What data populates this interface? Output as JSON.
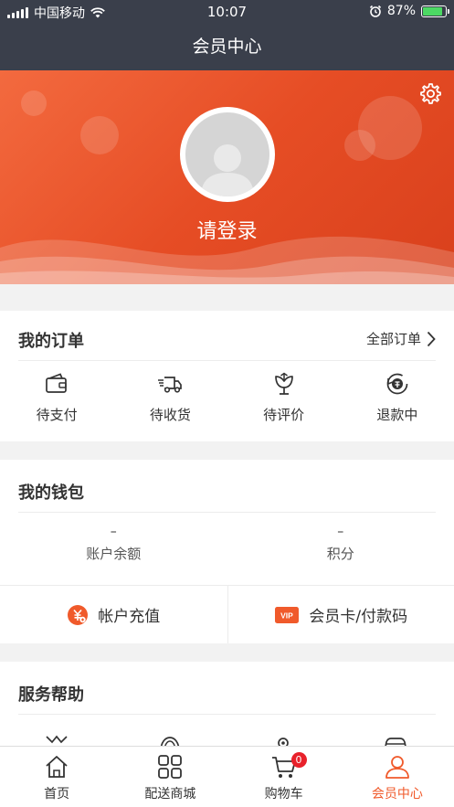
{
  "status": {
    "carrier": "中国移动",
    "time": "10:07",
    "battery": "87%",
    "battery_level": 0.87
  },
  "nav": {
    "title": "会员中心"
  },
  "profile": {
    "login_text": "请登录"
  },
  "orders": {
    "title": "我的订单",
    "all_label": "全部订单",
    "items": [
      {
        "label": "待支付",
        "icon": "wallet-icon"
      },
      {
        "label": "待收货",
        "icon": "delivery-truck-icon"
      },
      {
        "label": "待评价",
        "icon": "flower-icon"
      },
      {
        "label": "退款中",
        "icon": "refund-icon"
      }
    ]
  },
  "wallet": {
    "title": "我的钱包",
    "balance": {
      "value": "–",
      "label": "账户余额"
    },
    "points": {
      "value": "–",
      "label": "积分"
    },
    "recharge_label": "帐户充值",
    "card_label": "会员卡/付款码",
    "vip_text": "VIP"
  },
  "services": {
    "title": "服务帮助"
  },
  "tabs": [
    {
      "label": "首页",
      "icon": "home-icon"
    },
    {
      "label": "配送商城",
      "icon": "grid-icon"
    },
    {
      "label": "购物车",
      "icon": "cart-icon",
      "badge": "0"
    },
    {
      "label": "会员中心",
      "icon": "user-icon",
      "active": true
    }
  ],
  "colors": {
    "accent": "#f05a2b",
    "header_bg": "#3a3f4b",
    "badge": "#e8212b"
  }
}
